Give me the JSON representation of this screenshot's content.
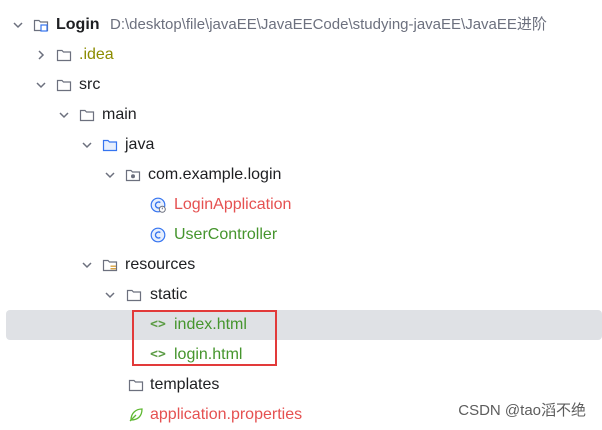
{
  "project": {
    "name": "Login",
    "path": "D:\\desktop\\file\\javaEE\\JavaEECode\\studying-javaEE\\JavaEE进阶"
  },
  "tree": {
    "idea": ".idea",
    "src": "src",
    "main": "main",
    "java": "java",
    "package": "com.example.login",
    "login_application": "LoginApplication",
    "user_controller": "UserController",
    "resources": "resources",
    "static": "static",
    "index_html": "index.html",
    "login_html": "login.html",
    "templates": "templates",
    "application_properties": "application.properties"
  },
  "html_icon_glyph": "<>",
  "watermark": "CSDN @tao滔不绝",
  "colors": {
    "selection": "#dfe1e5",
    "highlight_box": "#e23a3a",
    "modified_red": "#e55151",
    "added_green": "#45952d",
    "idea_olive": "#8c8c00"
  }
}
